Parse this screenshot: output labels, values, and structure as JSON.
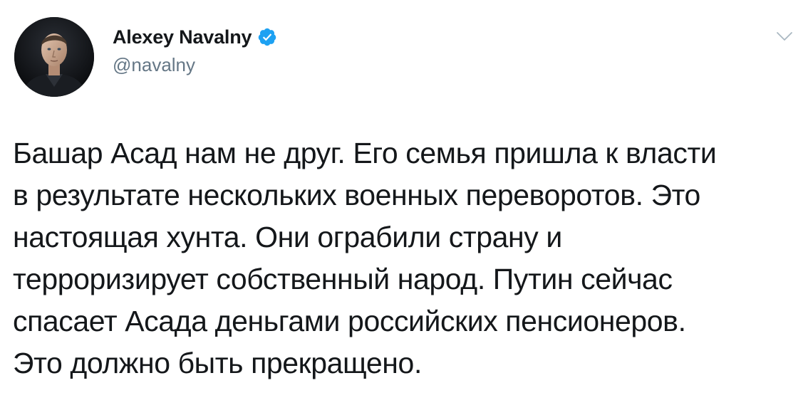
{
  "author": {
    "name": "Alexey Navalny",
    "handle": "@navalny",
    "verified": true,
    "verified_color": "#1da1f2",
    "avatar_icon": "person-portrait"
  },
  "tweet": {
    "text": "Башар Асад нам не друг. Его семья пришла к власти\nв результате нескольких военных переворотов. Это\nнастоящая хунта. Они ограбили страну и\nтерроризирует собственный народ. Путин сейчас\nспасает Асада деньгами российских пенсионеров.\nЭто должно быть прекращено."
  },
  "menu": {
    "icon": "chevron-down-icon",
    "color": "#aab8c2"
  }
}
